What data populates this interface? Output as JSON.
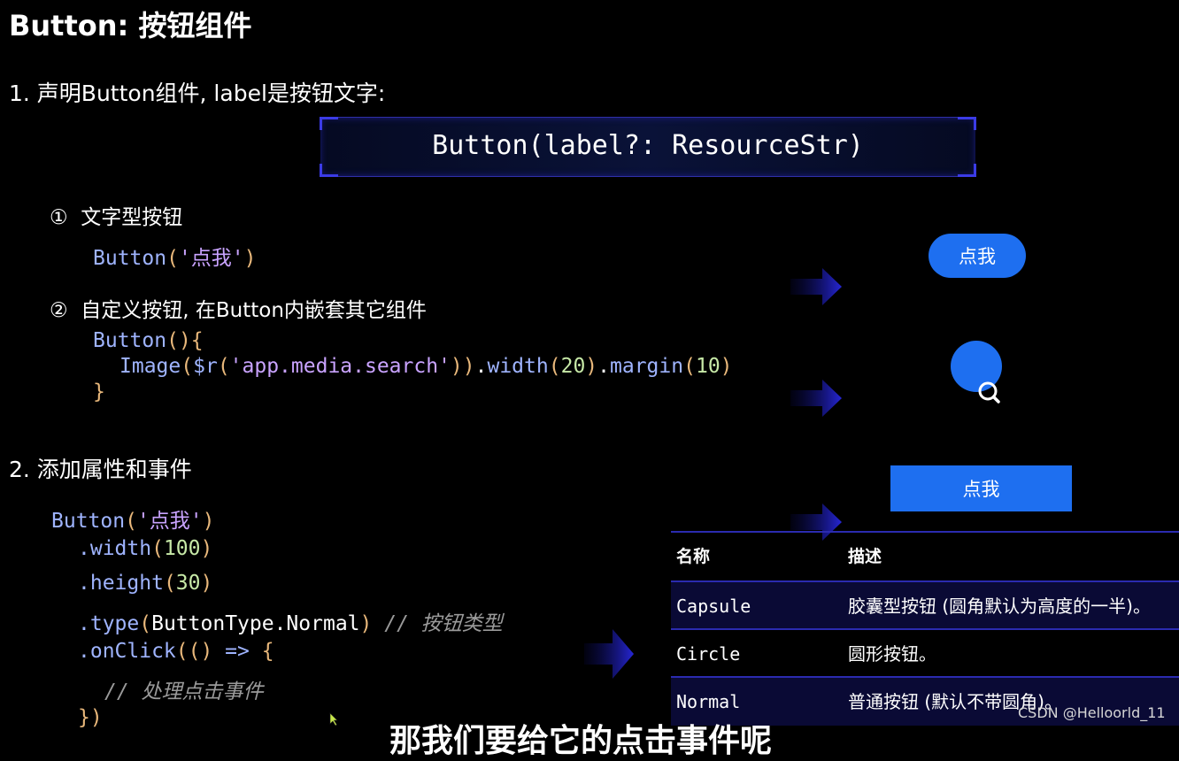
{
  "title": "Button: 按钮组件",
  "section1": {
    "heading": "1. 声明Button组件, label是按钮文字:",
    "declaration": "Button(label?: ResourceStr)",
    "item1": {
      "label": "①  文字型按钮",
      "code_fn": "Button",
      "code_open": "(",
      "code_str": "'点我'",
      "code_close": ")"
    },
    "item2": {
      "label": "②  自定义按钮, 在Button内嵌套其它组件",
      "line1_fn": "Button",
      "line1_paren": "(){",
      "line2_fn": "Image",
      "line2_p1": "(",
      "line2_r": "$r",
      "line2_p2": "(",
      "line2_str": "'app.media.search'",
      "line2_p3": "))",
      "line2_dot1": ".",
      "line2_width": "width",
      "line2_p4": "(",
      "line2_n1": "20",
      "line2_p5": ")",
      "line2_dot2": ".",
      "line2_margin": "margin",
      "line2_p6": "(",
      "line2_n2": "10",
      "line2_p7": ")",
      "line3": "}"
    }
  },
  "section2": {
    "heading": "2. 添加属性和事件",
    "l1_fn": "Button",
    "l1_p1": "(",
    "l1_str": "'点我'",
    "l1_p2": ")",
    "l2_fn": ".width",
    "l2_p1": "(",
    "l2_num": "100",
    "l2_p2": ")",
    "l3_fn": ".height",
    "l3_p1": "(",
    "l3_num": "30",
    "l3_p2": ")",
    "l4_fn": ".type",
    "l4_p1": "(",
    "l4_arg": "ButtonType.Normal",
    "l4_p2": ")",
    "l4_comment": "// 按钮类型",
    "l5_fn": ".onClick",
    "l5_p1": "(() ",
    "l5_arrow": "=>",
    "l5_brace": " {",
    "l6_comment": "// 处理点击事件",
    "l7": "})"
  },
  "previews": {
    "capsule_label": "点我",
    "normal_label": "点我"
  },
  "table": {
    "headers": [
      "名称",
      "描述"
    ],
    "rows": [
      [
        "Capsule",
        "胶囊型按钮 (圆角默认为高度的一半)。"
      ],
      [
        "Circle",
        "圆形按钮。"
      ],
      [
        "Normal",
        "普通按钮 (默认不带圆角)。"
      ]
    ]
  },
  "watermark": "CSDN @Helloorld_11",
  "subtitle_partial": "那我们要给它的点击事件呢",
  "colors": {
    "accent_blue": "#1e6ff0",
    "code_fn": "#9fb4ff",
    "code_str": "#c9a3ff",
    "code_paren": "#e9b87b",
    "code_num": "#c7e9a7",
    "table_line": "#2b2bb0"
  }
}
